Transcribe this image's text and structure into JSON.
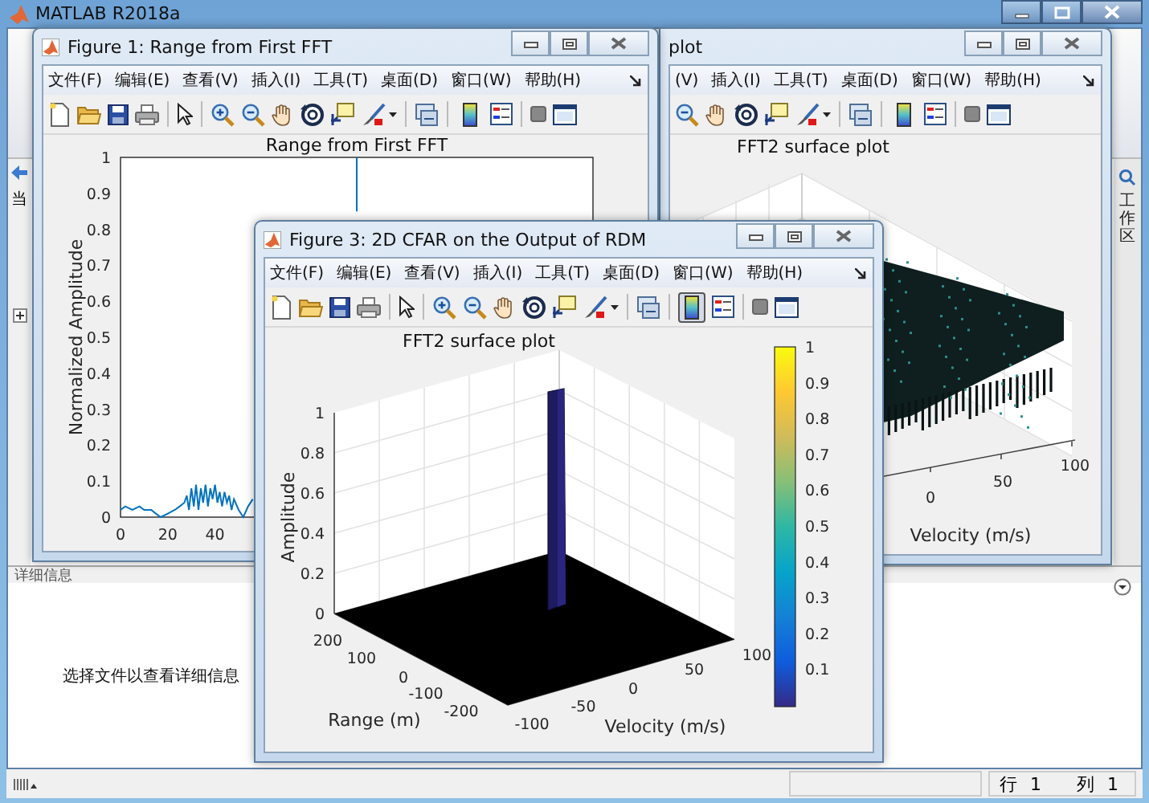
{
  "app": {
    "title": "MATLAB R2018a"
  },
  "side_labels": {
    "left": "当",
    "right": "工作区"
  },
  "figures": [
    {
      "kind": "surface_noise",
      "title": "plot",
      "menu": [
        "(V)",
        "插入(I)",
        "工具(T)",
        "桌面(D)",
        "窗口(W)",
        "帮助(H)"
      ],
      "colorbar_on": false,
      "plot": {
        "title": "FFT2 surface plot",
        "xlabel": "Velocity (m/s)",
        "xticks": [
          "0",
          "50",
          "100"
        ]
      }
    },
    {
      "kind": "line",
      "title": "Figure 1: Range from First FFT",
      "menu": [
        "文件(F)",
        "编辑(E)",
        "查看(V)",
        "插入(I)",
        "工具(T)",
        "桌面(D)",
        "窗口(W)",
        "帮助(H)"
      ],
      "colorbar_on": false,
      "plot": {
        "chart_data": {
          "type": "line",
          "title": "Range from First FFT",
          "ylabel": "Normalized Amplitude",
          "xlim": [
            0,
            200
          ],
          "ylim": [
            0,
            1
          ],
          "xticks": [
            0,
            20,
            40
          ],
          "yticks": [
            0,
            0.1,
            0.2,
            0.3,
            0.4,
            0.5,
            0.6,
            0.7,
            0.8,
            0.9,
            1
          ],
          "x": [
            0,
            2,
            5,
            8,
            10,
            13,
            15,
            17,
            20,
            23,
            25,
            27,
            28,
            29,
            30,
            31,
            32,
            33,
            34,
            35,
            36,
            37,
            38,
            39,
            40,
            41,
            42,
            43,
            44,
            45,
            46,
            47,
            48,
            50,
            52,
            54,
            56,
            57,
            100,
            100
          ],
          "series": [
            {
              "color": "#0072bd",
              "values": [
                0.02,
                0.03,
                0.02,
                0.03,
                0.02,
                0.02,
                0.01,
                0.0,
                0.01,
                0.02,
                0.03,
                0.04,
                0.06,
                0.02,
                0.08,
                0.03,
                0.09,
                0.02,
                0.08,
                0.04,
                0.09,
                0.03,
                0.08,
                0.05,
                0.09,
                0.04,
                0.07,
                0.03,
                0.07,
                0.04,
                0.06,
                0.02,
                0.05,
                0.02,
                0.0,
                0.03,
                0.05,
                null,
                0.85,
                1
              ]
            }
          ]
        }
      }
    },
    {
      "kind": "surface_peak",
      "title": "Figure 3: 2D CFAR on the Output of RDM",
      "menu": [
        "文件(F)",
        "编辑(E)",
        "查看(V)",
        "插入(I)",
        "工具(T)",
        "桌面(D)",
        "窗口(W)",
        "帮助(H)"
      ],
      "colorbar_on": true,
      "plot": {
        "title": "FFT2 surface plot",
        "zlabel": "Amplitude",
        "zticks": [
          "1",
          "0.8",
          "0.6",
          "0.4",
          "0.2",
          "0"
        ],
        "ylabel": "Range (m)",
        "yticks": [
          "200",
          "100",
          "0",
          "-100",
          "-200"
        ],
        "xlabel": "Velocity (m/s)",
        "xticks": [
          "-100",
          "-50",
          "0",
          "50",
          "100"
        ],
        "colorbar_ticks": [
          "1",
          "0.9",
          "0.8",
          "0.7",
          "0.6",
          "0.5",
          "0.4",
          "0.3",
          "0.2",
          "0.1"
        ]
      }
    }
  ],
  "details": {
    "title": "详细信息",
    "message": "选择文件以查看详细信息"
  },
  "status_bar": {
    "row_label": "行",
    "row": "1",
    "col_label": "列",
    "col": "1"
  }
}
